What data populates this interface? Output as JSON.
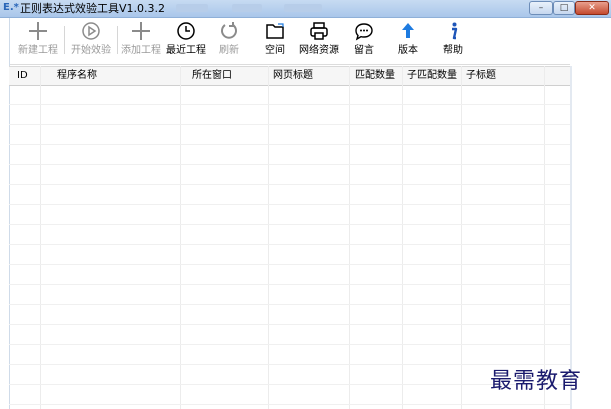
{
  "window": {
    "title": "正则表达式效验工具V1.0.3.2",
    "minimize_glyph": "–",
    "maximize_glyph": "□",
    "close_glyph": "✕"
  },
  "toolbar": {
    "items": [
      {
        "label": "新建工程",
        "icon": "plus-icon",
        "enabled": false
      },
      {
        "label": "开始效验",
        "icon": "play-circle-icon",
        "enabled": false
      },
      {
        "label": "添加工程",
        "icon": "plus-icon",
        "enabled": false
      },
      {
        "label": "最近工程",
        "icon": "clock-icon",
        "enabled": true
      },
      {
        "label": "刷新",
        "icon": "refresh-icon",
        "enabled": false
      },
      {
        "label": "空间",
        "icon": "folder-icon",
        "enabled": true
      },
      {
        "label": "网络资源",
        "icon": "printer-icon",
        "enabled": true
      },
      {
        "label": "留言",
        "icon": "chat-bubble-icon",
        "enabled": true
      },
      {
        "label": "版本",
        "icon": "arrow-up-icon",
        "enabled": true
      },
      {
        "label": "帮助",
        "icon": "info-icon",
        "enabled": true
      }
    ]
  },
  "table": {
    "columns": [
      "ID",
      "程序名称",
      "所在窗口",
      "网页标题",
      "匹配数量",
      "子匹配数量",
      "子标题"
    ],
    "rows": []
  },
  "watermark": "最需教育",
  "colors": {
    "titlebar": "#b7cfee",
    "accent_blue": "#1e7be0",
    "watermark": "#1a1a6e"
  }
}
